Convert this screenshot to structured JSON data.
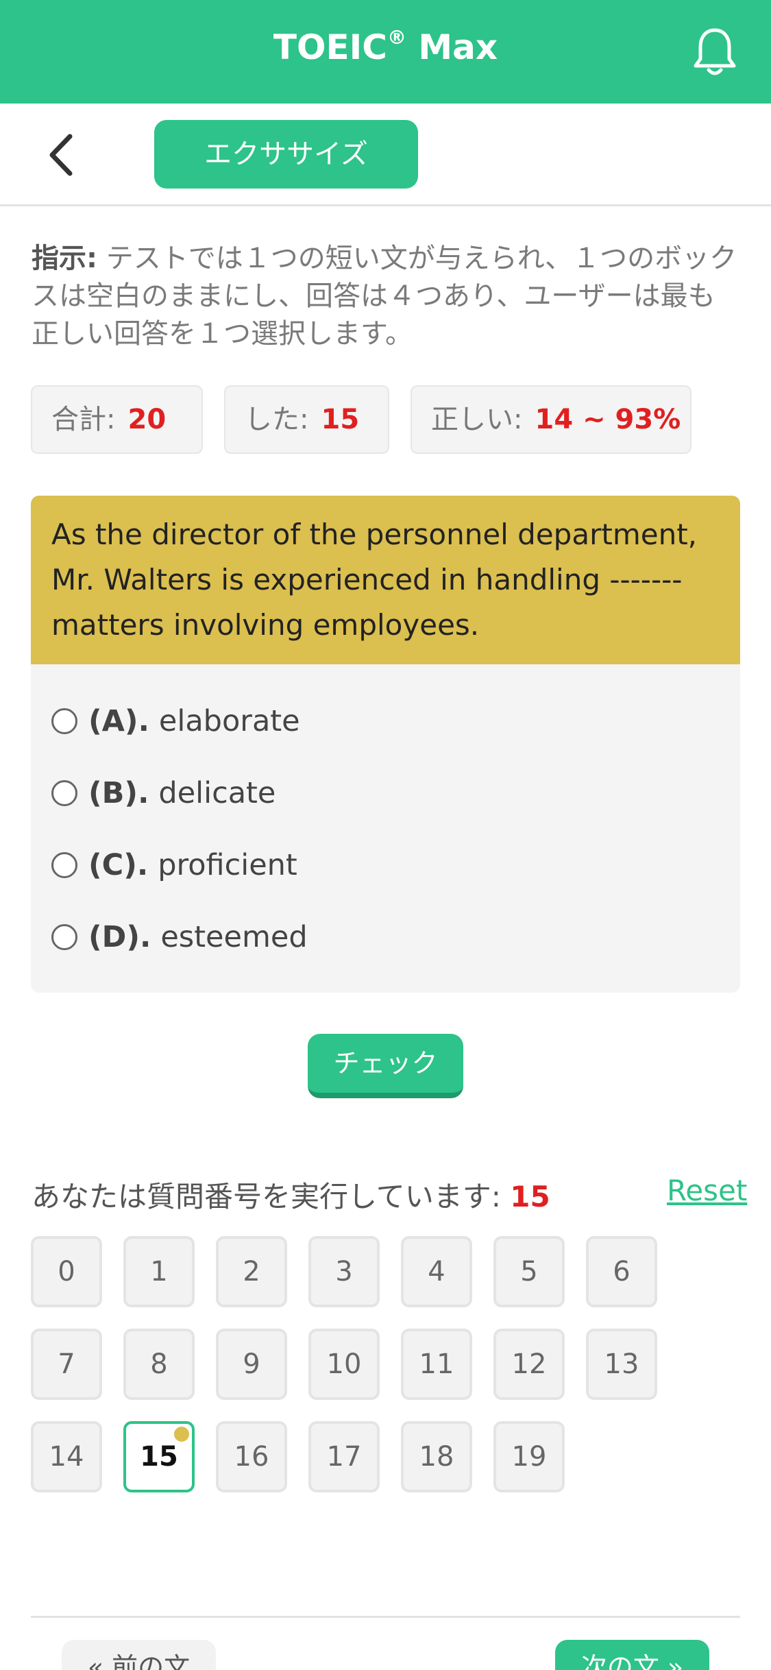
{
  "app": {
    "title": "TOEIC",
    "title_mark": "®",
    "title_suffix": " Max"
  },
  "header": {
    "tab_label": "エクササイズ",
    "back_icon": "chevron-left-icon",
    "bell_icon": "bell-icon"
  },
  "instruction": {
    "label": "指示:",
    "text": " テストでは１つの短い文が与えられ、１つのボックスは空白のままにし、回答は４つあり、ユーザーは最も正しい回答を１つ選択します。"
  },
  "stats": {
    "total_label": "合計:",
    "total_value": "20",
    "done_label": "した:",
    "done_value": "15",
    "correct_label": "正しい:",
    "correct_value": "14 ~ 93%"
  },
  "question": {
    "text": "As the director of the personnel department, Mr. Walters is experienced in handling ------- matters involving employees.",
    "options": [
      {
        "key": "(A).",
        "text": "elaborate"
      },
      {
        "key": "(B).",
        "text": "delicate"
      },
      {
        "key": "(C).",
        "text": "proficient"
      },
      {
        "key": "(D).",
        "text": "esteemed"
      }
    ]
  },
  "check_label": "チェック",
  "progress": {
    "running_label": "あなたは質問番号を実行しています:",
    "current": "15",
    "reset_label": "Reset",
    "numbers": [
      "0",
      "1",
      "2",
      "3",
      "4",
      "5",
      "6",
      "7",
      "8",
      "9",
      "10",
      "11",
      "12",
      "13",
      "14",
      "15",
      "16",
      "17",
      "18",
      "19"
    ]
  },
  "footer": {
    "prev_label": "« 前の文",
    "next_label": "次の文 »"
  },
  "colors": {
    "accent": "#2dc38a",
    "question_bg": "#dbbf4f",
    "highlight": "#e02020"
  }
}
